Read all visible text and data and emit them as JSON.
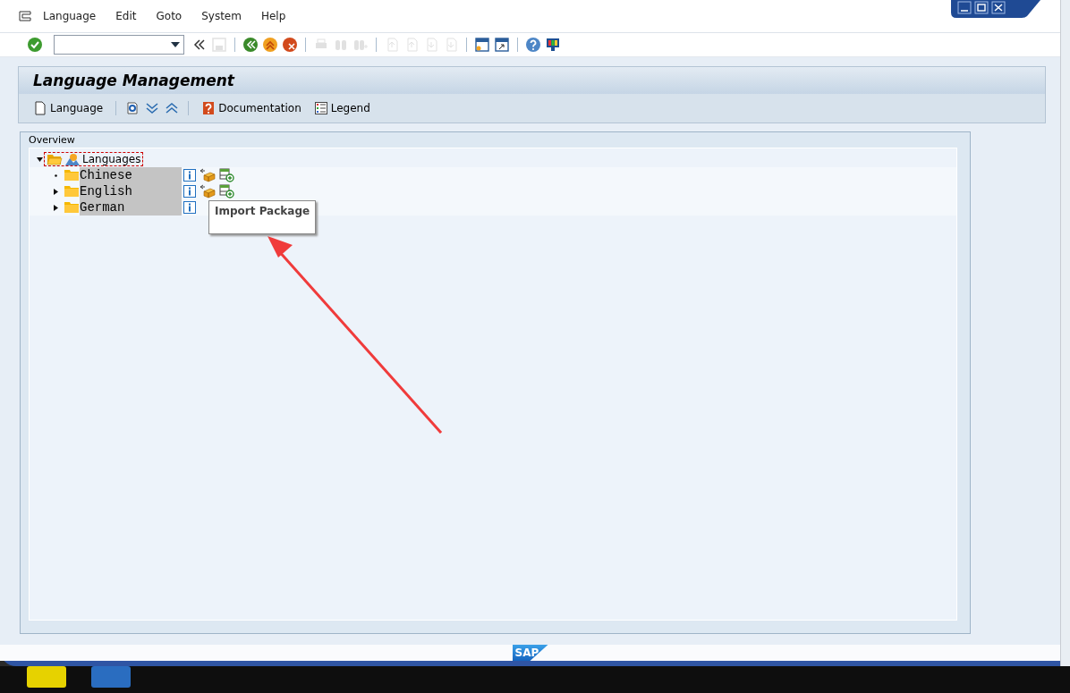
{
  "menu_bar": [
    {
      "label": "Language"
    },
    {
      "label": "Edit"
    },
    {
      "label": "Goto"
    },
    {
      "label": "System"
    },
    {
      "label": "Help"
    }
  ],
  "toolbar": {
    "buttons": [
      {
        "kind": "enter",
        "disabled": false
      },
      {
        "kind": "collapse",
        "disabled": false
      },
      {
        "kind": "save",
        "disabled": true
      },
      {
        "kind": "sep"
      },
      {
        "kind": "back",
        "disabled": false
      },
      {
        "kind": "exit",
        "disabled": false
      },
      {
        "kind": "cancel",
        "disabled": false
      },
      {
        "kind": "sep"
      },
      {
        "kind": "print",
        "disabled": true
      },
      {
        "kind": "find",
        "disabled": true
      },
      {
        "kind": "findnext",
        "disabled": true
      },
      {
        "kind": "sep"
      },
      {
        "kind": "first",
        "disabled": true
      },
      {
        "kind": "prev",
        "disabled": true
      },
      {
        "kind": "next",
        "disabled": true
      },
      {
        "kind": "last",
        "disabled": true
      },
      {
        "kind": "sep"
      },
      {
        "kind": "newsession",
        "disabled": false
      },
      {
        "kind": "shortcut",
        "disabled": false
      },
      {
        "kind": "sep"
      },
      {
        "kind": "help",
        "disabled": false
      },
      {
        "kind": "layout",
        "disabled": false
      }
    ]
  },
  "title": "Language Management",
  "app_toolbar": [
    {
      "kind": "new",
      "label": "Language"
    },
    {
      "kind": "sep"
    },
    {
      "kind": "refresh"
    },
    {
      "kind": "expand"
    },
    {
      "kind": "collapse"
    },
    {
      "kind": "sep"
    },
    {
      "kind": "doc",
      "label": "Documentation"
    },
    {
      "kind": "legend",
      "label": "Legend"
    }
  ],
  "overview": {
    "title": "Overview",
    "tree": {
      "label": "Languages",
      "expanded": true,
      "children": [
        {
          "label": "Chinese",
          "expandable": false,
          "actions": [
            {
              "kind": "info"
            },
            {
              "kind": "package"
            },
            {
              "kind": "add"
            }
          ]
        },
        {
          "label": "English",
          "expandable": true,
          "expanded": false,
          "actions": [
            {
              "kind": "info"
            },
            {
              "kind": "package"
            },
            {
              "kind": "add"
            }
          ]
        },
        {
          "label": "German",
          "expandable": true,
          "expanded": false,
          "actions": [
            {
              "kind": "info"
            }
          ]
        }
      ]
    }
  },
  "tooltip": "Import Package",
  "logo": "SAP"
}
